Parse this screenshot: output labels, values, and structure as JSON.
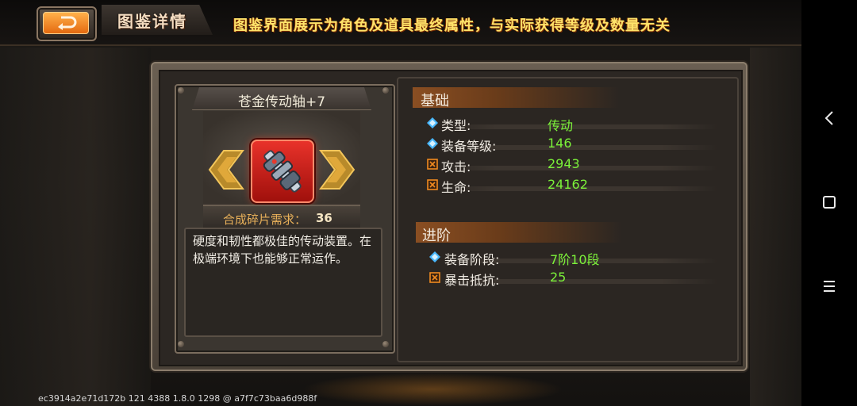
{
  "header": {
    "title": "图鉴详情",
    "notice": "图鉴界面展示为角色及道具最终属性，与实际获得等级及数量无关"
  },
  "item": {
    "name": "苍金传动轴+7",
    "shard_label": "合成碎片需求：",
    "shard_value": "36",
    "description": "硬度和韧性都极佳的传动装置。在极端环境下也能够正常运作。"
  },
  "sections": {
    "basic": {
      "title": "基础",
      "stats": [
        {
          "label": "类型:",
          "value": "传动",
          "icon": "diamond-icon"
        },
        {
          "label": "装备等级:",
          "value": "146",
          "icon": "diamond-icon"
        },
        {
          "label": "攻击:",
          "value": "2943",
          "icon": "crossed-box-icon"
        },
        {
          "label": "生命:",
          "value": "24162",
          "icon": "crossed-box-icon"
        }
      ]
    },
    "advance": {
      "title": "进阶",
      "stats": [
        {
          "label": "装备阶段:",
          "value": "7阶10段",
          "icon": "diamond-icon"
        },
        {
          "label": "暴击抵抗:",
          "value": "25",
          "icon": "crossed-box-icon"
        }
      ]
    }
  },
  "build_id": "ec3914a2e71d172b 121 4388 1.8.0 1298 @ a7f7c73baa6d988f",
  "colors": {
    "value_green": "#7cf23a",
    "accent_orange": "#e46a10",
    "notice_yellow": "#ffe36a",
    "rarity_red": "#e8322a"
  },
  "navigation": {
    "back_icon": "chevron-left-icon",
    "home_icon": "square-icon",
    "menu_icon": "hamburger-icon"
  }
}
